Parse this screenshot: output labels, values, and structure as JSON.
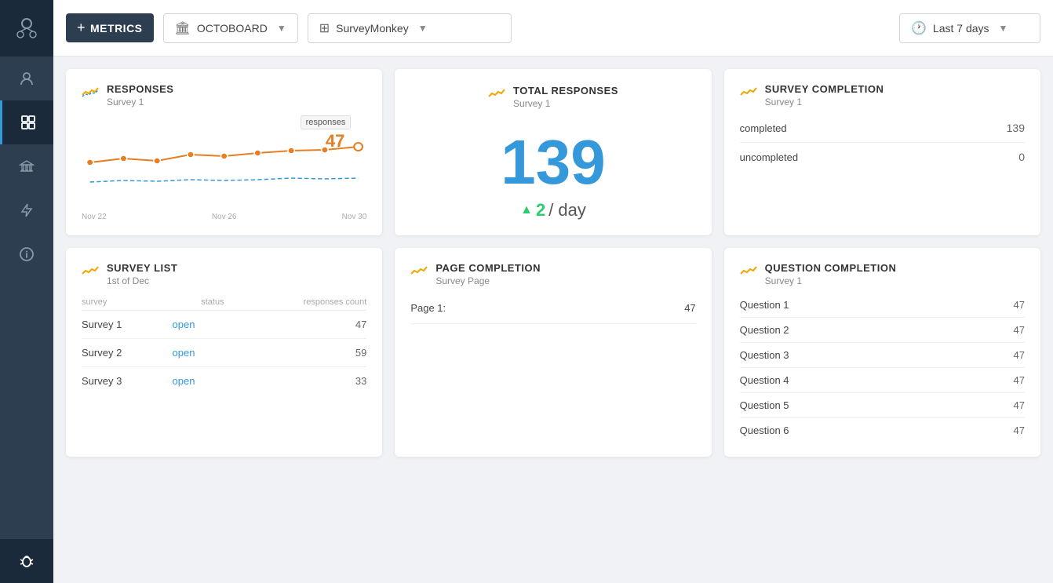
{
  "topbar": {
    "add_label": "METRICS",
    "add_icon": "+",
    "octoboard_label": "OCTOBOARD",
    "octoboard_icon": "🏛",
    "surveymonkey_label": "SurveyMonkey",
    "surveymonkey_icon": "⊞",
    "time_label": "Last 7 days",
    "time_icon": "🕐"
  },
  "sidebar": {
    "items": [
      {
        "icon": "👤",
        "name": "user"
      },
      {
        "icon": "⊞",
        "name": "dashboard"
      },
      {
        "icon": "🏛",
        "name": "bank"
      },
      {
        "icon": "⚡",
        "name": "lightning"
      },
      {
        "icon": "ℹ",
        "name": "info"
      },
      {
        "icon": "🐛",
        "name": "bug"
      }
    ]
  },
  "responses_card": {
    "title": "RESPONSES",
    "subtitle": "Survey 1",
    "tooltip": "responses",
    "current_value": "47",
    "dates": [
      "Nov 22",
      "Nov 26",
      "Nov 30"
    ]
  },
  "total_responses_card": {
    "title": "TOTAL RESPONSES",
    "subtitle": "Survey 1",
    "total": "139",
    "per_day": "2",
    "per_day_label": "/ day"
  },
  "survey_completion_card": {
    "title": "SURVEY COMPLETION",
    "subtitle": "Survey 1",
    "rows": [
      {
        "label": "completed",
        "value": "139"
      },
      {
        "label": "uncompleted",
        "value": "0"
      }
    ]
  },
  "survey_list_card": {
    "title": "SURVEY LIST",
    "subtitle": "1st of Dec",
    "headers": {
      "survey": "survey",
      "status": "status",
      "count": "responses count"
    },
    "rows": [
      {
        "name": "Survey 1",
        "status": "open",
        "count": "47"
      },
      {
        "name": "Survey 2",
        "status": "open",
        "count": "59"
      },
      {
        "name": "Survey 3",
        "status": "open",
        "count": "33"
      }
    ]
  },
  "page_completion_card": {
    "title": "PAGE COMPLETION",
    "subtitle": "Survey Page",
    "rows": [
      {
        "label": "Page 1:",
        "value": "47"
      }
    ]
  },
  "question_completion_card": {
    "title": "QUESTION COMPLETION",
    "subtitle": "Survey 1",
    "rows": [
      {
        "label": "Question 1",
        "value": "47"
      },
      {
        "label": "Question 2",
        "value": "47"
      },
      {
        "label": "Question 3",
        "value": "47"
      },
      {
        "label": "Question 4",
        "value": "47"
      },
      {
        "label": "Question 5",
        "value": "47"
      },
      {
        "label": "Question 6",
        "value": "47"
      }
    ]
  },
  "colors": {
    "orange": "#f0a500",
    "blue": "#3498db",
    "green": "#2ecc71",
    "sidebar_bg": "#2c3e50"
  }
}
